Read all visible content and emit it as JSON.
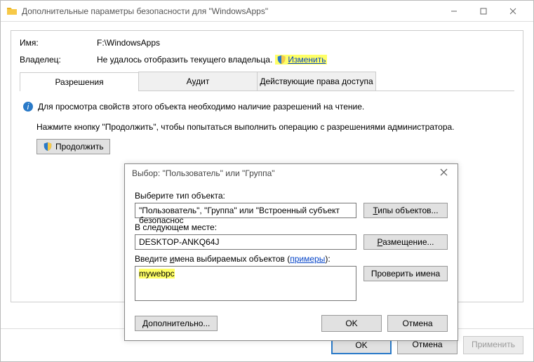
{
  "titlebar": {
    "text": "Дополнительные параметры безопасности  для \"WindowsApps\""
  },
  "fields": {
    "name_label": "Имя:",
    "name_value": "F:\\WindowsApps",
    "owner_label": "Владелец:",
    "owner_value": "Не удалось отобразить текущего владельца.",
    "change_link": "Изменить"
  },
  "tabs": {
    "perm": "Разрешения",
    "audit": "Аудит",
    "effective": "Действующие права доступа"
  },
  "pane": {
    "info": "Для просмотра свойств этого объекта необходимо наличие разрешений на чтение.",
    "instr": "Нажмите кнопку \"Продолжить\", чтобы попытаться выполнить операцию с разрешениями администратора.",
    "continue": "Продолжить"
  },
  "footer": {
    "ok": "OK",
    "cancel": "Отмена",
    "apply": "Применить"
  },
  "modal": {
    "title": "Выбор: \"Пользователь\" или \"Группа\"",
    "obj_label": "Выберите тип объекта:",
    "obj_value": "\"Пользователь\", \"Группа\" или \"Встроенный субъект безопаснос",
    "obj_btn": "Типы объектов...",
    "loc_label": "В следующем месте:",
    "loc_value": "DESKTOP-ANKQ64J",
    "loc_btn": "Размещение...",
    "names_label_pre": "Введите ",
    "names_label_und": "и",
    "names_label_post": "мена выбираемых объектов (",
    "names_examples": "примеры",
    "names_label_end": "):",
    "names_value": "mywebpc",
    "check_btn": "Проверить имена",
    "advanced": "Дополнительно...",
    "ok": "OK",
    "cancel": "Отмена"
  }
}
